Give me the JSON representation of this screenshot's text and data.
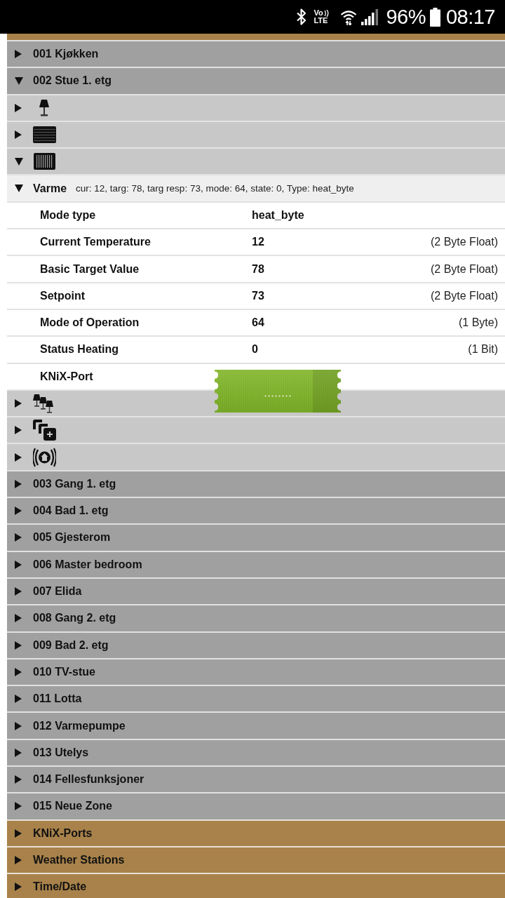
{
  "status_bar": {
    "volte": [
      "Vo",
      "LTE"
    ],
    "battery": "96%",
    "time": "08:17"
  },
  "zones": [
    {
      "label": "001 Kjøkken",
      "expanded": false
    },
    {
      "label": "002 Stue 1. etg",
      "expanded": true,
      "categories": [
        {
          "kind": "lamp",
          "expanded": false
        },
        {
          "kind": "blinds",
          "expanded": false
        },
        {
          "kind": "radiator",
          "expanded": true,
          "devices": [
            {
              "name": "Varme",
              "summary": "cur: 12, targ: 78, targ resp: 73, mode: 64, state: 0, Type: heat_byte",
              "expanded": true,
              "properties": [
                {
                  "kind": "text",
                  "label": "Mode type",
                  "value": "heat_byte"
                },
                {
                  "kind": "text",
                  "label": "Current Temperature",
                  "value": "12",
                  "type": "(2 Byte Float)"
                },
                {
                  "kind": "text",
                  "label": "Basic Target Value",
                  "value": "78",
                  "type": "(2 Byte Float)"
                },
                {
                  "kind": "text",
                  "label": "Setpoint",
                  "value": "73",
                  "type": "(2 Byte Float)"
                },
                {
                  "kind": "text",
                  "label": "Mode of Operation",
                  "value": "64",
                  "type": "(1 Byte)"
                },
                {
                  "kind": "text",
                  "label": "Status Heating",
                  "value": "0",
                  "type": "(1 Bit)"
                },
                {
                  "kind": "switch",
                  "label": "KNiX-Port"
                }
              ]
            }
          ]
        },
        {
          "kind": "lamps",
          "expanded": false
        },
        {
          "kind": "stack",
          "expanded": false
        },
        {
          "kind": "beacon",
          "expanded": false
        }
      ]
    },
    {
      "label": "003 Gang 1. etg",
      "expanded": false
    },
    {
      "label": "004 Bad 1. etg",
      "expanded": false
    },
    {
      "label": "005 Gjesterom",
      "expanded": false
    },
    {
      "label": "006 Master bedroom",
      "expanded": false
    },
    {
      "label": "007 Elida",
      "expanded": false
    },
    {
      "label": "008 Gang 2. etg",
      "expanded": false
    },
    {
      "label": "009 Bad 2. etg",
      "expanded": false
    },
    {
      "label": "010 TV-stue",
      "expanded": false
    },
    {
      "label": "011 Lotta",
      "expanded": false
    },
    {
      "label": "012 Varmepumpe",
      "expanded": false
    },
    {
      "label": "013 Utelys",
      "expanded": false
    },
    {
      "label": "014 Fellesfunksjoner",
      "expanded": false
    },
    {
      "label": "015 Neue Zone",
      "expanded": false
    }
  ],
  "sections": [
    {
      "label": "KNiX-Ports",
      "expanded": false
    },
    {
      "label": "Weather Stations",
      "expanded": false
    },
    {
      "label": "Time/Date",
      "expanded": false
    }
  ]
}
